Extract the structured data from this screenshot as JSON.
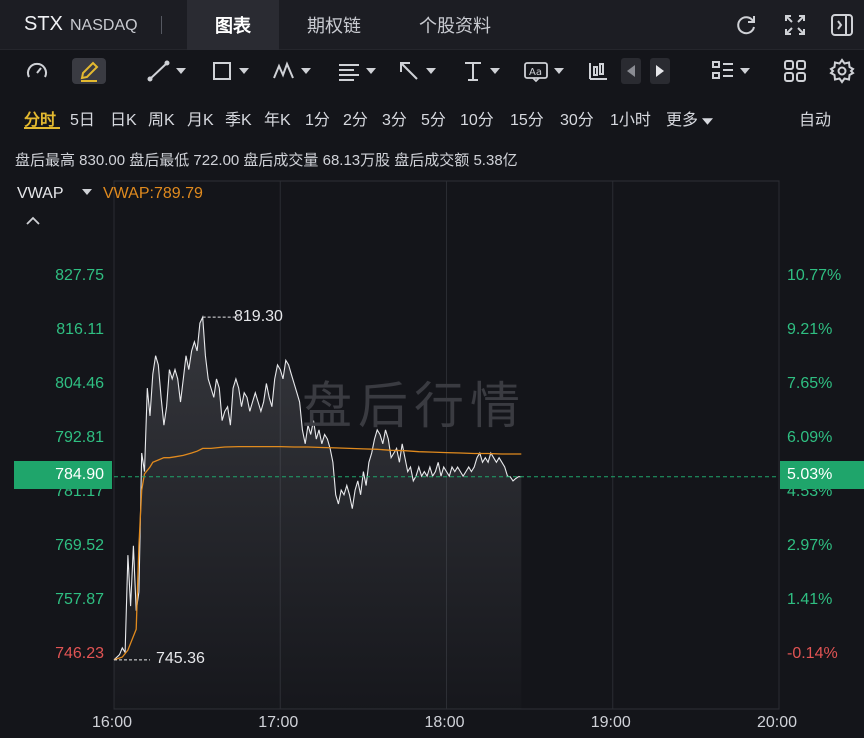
{
  "header": {
    "ticker": "STX",
    "exchange": "NASDAQ",
    "tabs": [
      {
        "label": "图表",
        "active": true
      },
      {
        "label": "期权链",
        "active": false
      },
      {
        "label": "个股资料",
        "active": false
      }
    ],
    "icons": [
      "refresh-icon",
      "fullscreen-icon",
      "exit-panel-icon"
    ]
  },
  "toolbar": {
    "icons": [
      "gauge-icon",
      "pencil-icon",
      "trend-line-icon",
      "rectangle-icon",
      "pattern-icon",
      "fib-icon",
      "arrow-icon",
      "text-marker-icon",
      "text-box-icon",
      "candle-icon",
      "prev-icon",
      "next-icon",
      "layout-icon",
      "grid-icon",
      "settings-icon"
    ]
  },
  "periods": {
    "items": [
      "分时",
      "5日",
      "日K",
      "周K",
      "月K",
      "季K",
      "年K",
      "1分",
      "2分",
      "3分",
      "5分",
      "10分",
      "15分",
      "30分",
      "1小时",
      "更多"
    ],
    "active": "分时",
    "mode": "自动"
  },
  "stats": {
    "text": "盘后最高 830.00 盘后最低 722.00 盘后成交量 68.13万股 盘后成交额 5.38亿"
  },
  "indicator": {
    "name": "VWAP",
    "value_text": "VWAP:789.79"
  },
  "chart_data": {
    "type": "line",
    "title": "盘后行情",
    "xlabel": "",
    "ylabel": "",
    "x_ticks": [
      "16:00",
      "17:00",
      "18:00",
      "19:00",
      "20:00"
    ],
    "y_ticks_left": [
      "827.75",
      "816.11",
      "804.46",
      "792.81",
      "781.17",
      "769.52",
      "757.87",
      "746.23"
    ],
    "y_ticks_right": [
      "10.77%",
      "9.21%",
      "7.65%",
      "6.09%",
      "4.53%",
      "2.97%",
      "1.41%",
      "-0.14%"
    ],
    "ylim": [
      741,
      834
    ],
    "xlim_minutes": [
      0,
      240
    ],
    "current_price": "784.90",
    "current_pct": "5.03%",
    "high_label": "819.30",
    "low_label": "745.36",
    "colors": {
      "up": "#2fbf82",
      "down": "#e25454",
      "price": "#e8e9ec",
      "vwap": "#e08a1e",
      "bg": "#14151a"
    },
    "series": [
      {
        "name": "价格",
        "minutes": [
          0,
          2,
          3,
          4,
          5,
          6,
          7,
          8,
          9,
          10,
          11,
          12,
          13,
          14,
          15,
          16,
          17,
          18,
          19,
          20,
          21,
          22,
          23,
          24,
          25,
          26,
          27,
          28,
          29,
          30,
          31,
          32,
          33,
          34,
          35,
          36,
          37,
          38,
          39,
          40,
          41,
          42,
          43,
          44,
          45,
          46,
          47,
          48,
          49,
          50,
          51,
          52,
          53,
          54,
          55,
          56,
          57,
          58,
          59,
          60,
          61,
          62,
          63,
          64,
          65,
          66,
          67,
          68,
          69,
          70,
          71,
          72,
          73,
          74,
          75,
          76,
          77,
          78,
          79,
          80,
          81,
          82,
          83,
          84,
          85,
          86,
          87,
          88,
          89,
          90,
          91,
          92,
          93,
          94,
          95,
          96,
          97,
          98,
          99,
          100,
          101,
          102,
          103,
          104,
          105,
          106,
          107,
          108,
          109,
          110,
          111,
          112,
          113,
          114,
          115,
          116,
          117,
          118,
          119,
          120,
          121,
          122,
          123,
          124,
          125,
          126,
          127,
          128,
          129,
          130,
          131,
          132,
          133,
          134,
          135,
          136,
          137,
          138,
          139,
          140,
          141,
          142,
          143,
          144,
          145,
          146,
          147
        ],
        "values": [
          745.4,
          746.5,
          748.0,
          747.0,
          768.0,
          757.0,
          770.0,
          756.0,
          760.0,
          790.0,
          786.0,
          804.0,
          798.0,
          807.0,
          811.0,
          809.0,
          802.0,
          796.0,
          800.0,
          808.0,
          806.0,
          808.0,
          806.0,
          801.0,
          806.0,
          811.0,
          808.0,
          812.0,
          814.0,
          812.0,
          818.0,
          819.3,
          811.0,
          806.0,
          804.0,
          802.0,
          806.0,
          804.0,
          797.0,
          799.0,
          800.0,
          796.0,
          804.0,
          806.0,
          804.0,
          800.0,
          803.0,
          802.0,
          799.0,
          801.0,
          803.0,
          801.0,
          799.0,
          801.0,
          805.0,
          802.0,
          800.0,
          806.0,
          809.0,
          808.0,
          806.0,
          810.0,
          809.0,
          807.0,
          805.0,
          803.0,
          801.0,
          795.0,
          792.0,
          796.0,
          794.0,
          797.0,
          793.0,
          795.0,
          792.0,
          794.0,
          793.0,
          791.0,
          788.0,
          781.0,
          779.0,
          782.0,
          781.0,
          783.0,
          781.0,
          778.0,
          782.0,
          784.0,
          781.0,
          786.0,
          783.0,
          788.0,
          790.0,
          793.0,
          795.0,
          794.0,
          792.0,
          795.0,
          793.0,
          789.0,
          790.0,
          791.0,
          788.0,
          792.0,
          789.0,
          786.0,
          787.0,
          784.0,
          785.0,
          787.0,
          785.0,
          786.0,
          785.0,
          787.0,
          785.0,
          786.0,
          788.0,
          785.0,
          787.0,
          786.0,
          785.0,
          787.0,
          786.0,
          787.0,
          786.0,
          785.0,
          786.0,
          787.0,
          786.0,
          787.0,
          789.0,
          790.0,
          788.0,
          789.0,
          788.0,
          790.0,
          789.0,
          788.0,
          789.0,
          788.0,
          787.0,
          785.0,
          784.9,
          784.0,
          784.5,
          784.9,
          784.9
        ]
      },
      {
        "name": "VWAP",
        "minutes": [
          0,
          3,
          5,
          8,
          9,
          10,
          11,
          13,
          14,
          16,
          18,
          20,
          22,
          25,
          28,
          30,
          32,
          35,
          38,
          40,
          45,
          50,
          55,
          60,
          65,
          70,
          75,
          80,
          85,
          90,
          95,
          100,
          105,
          110,
          115,
          120,
          125,
          130,
          135,
          140,
          145,
          147
        ],
        "values": [
          745.4,
          746.0,
          747.5,
          752.0,
          770.0,
          782.0,
          785.5,
          787.0,
          788.0,
          788.5,
          789.0,
          789.0,
          789.2,
          789.5,
          790.0,
          790.4,
          791.0,
          791.0,
          791.2,
          791.3,
          791.4,
          791.4,
          791.4,
          791.4,
          791.3,
          791.3,
          791.2,
          791.1,
          791.0,
          790.9,
          790.8,
          790.6,
          790.5,
          790.3,
          790.2,
          790.1,
          790.0,
          789.9,
          789.9,
          789.8,
          789.8,
          789.79
        ]
      }
    ]
  }
}
